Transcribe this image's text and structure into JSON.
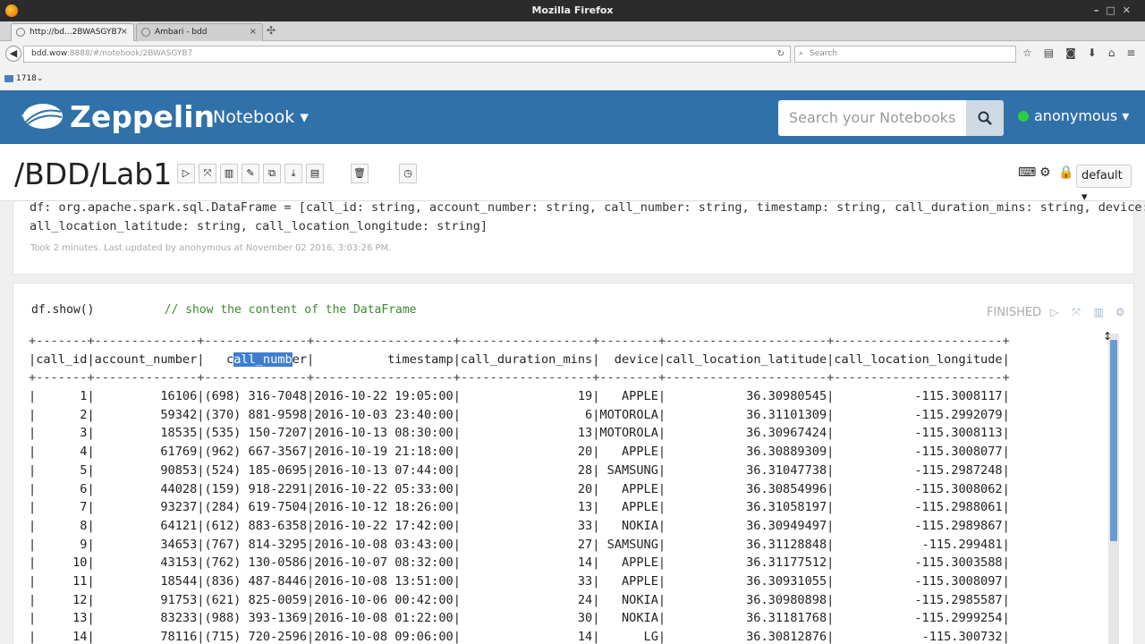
{
  "window": {
    "title": "Mozilla Firefox"
  },
  "tabs": [
    {
      "label": "http://bd...2BWASGYB7",
      "active": true
    },
    {
      "label": "Ambari - bdd",
      "active": false
    }
  ],
  "nav": {
    "url_host": "bdd.wow",
    "url_rest": ":8888/#/notebook/2BWASGYB7",
    "search_placeholder": "Search"
  },
  "bookmarks": {
    "item": "1718"
  },
  "zeppelin": {
    "brand": "Zeppelin",
    "notebook_menu": "Notebook ▾",
    "search_placeholder": "Search your Notebooks",
    "user": "anonymous ▾"
  },
  "notebook": {
    "title": "/BDD/Lab1",
    "interpreter": "default ▾"
  },
  "para1": {
    "output_lines": [
      "df: org.apache.spark.sql.DataFrame = [call_id: string, account_number: string, call_number: string, timestamp: string, call_duration_mins: string, device: string, c",
      "all_location_latitude: string, call_location_longitude: string]"
    ],
    "meta": "Took 2 minutes. Last updated by anonymous at November 02 2016, 3:03:26 PM."
  },
  "para2": {
    "code": "df.show()",
    "comment": "// show the content of the DataFrame",
    "status": "FINISHED",
    "border": "+-------+--------------+--------------+-------------------+------------------+--------+----------------------+-----------------------+",
    "header_cells": [
      "call_id",
      "account_number",
      "call_number",
      "timestamp",
      "call_duration_mins",
      "device",
      "call_location_latitude",
      "call_location_longitude"
    ],
    "rows": [
      [
        "1",
        "16106",
        "(698) 316-7048",
        "2016-10-22 19:05:00",
        "19",
        "APPLE",
        "36.30980545",
        "-115.3008117"
      ],
      [
        "2",
        "59342",
        "(370) 881-9598",
        "2016-10-03 23:40:00",
        "6",
        "MOTOROLA",
        "36.31101309",
        "-115.2992079"
      ],
      [
        "3",
        "18535",
        "(535) 150-7207",
        "2016-10-13 08:30:00",
        "13",
        "MOTOROLA",
        "36.30967424",
        "-115.3008113"
      ],
      [
        "4",
        "61769",
        "(962) 667-3567",
        "2016-10-19 21:18:00",
        "20",
        "APPLE",
        "36.30889309",
        "-115.3008077"
      ],
      [
        "5",
        "90853",
        "(524) 185-0695",
        "2016-10-13 07:44:00",
        "28",
        "SAMSUNG",
        "36.31047738",
        "-115.2987248"
      ],
      [
        "6",
        "44028",
        "(159) 918-2291",
        "2016-10-22 05:33:00",
        "20",
        "APPLE",
        "36.30854996",
        "-115.3008062"
      ],
      [
        "7",
        "93237",
        "(284) 619-7504",
        "2016-10-12 18:26:00",
        "13",
        "APPLE",
        "36.31058197",
        "-115.2988061"
      ],
      [
        "8",
        "64121",
        "(612) 883-6358",
        "2016-10-22 17:42:00",
        "33",
        "NOKIA",
        "36.30949497",
        "-115.2989867"
      ],
      [
        "9",
        "34653",
        "(767) 814-3295",
        "2016-10-08 03:43:00",
        "27",
        "SAMSUNG",
        "36.31128848",
        "-115.299481"
      ],
      [
        "10",
        "43153",
        "(762) 130-0586",
        "2016-10-07 08:32:00",
        "14",
        "APPLE",
        "36.31177512",
        "-115.3003588"
      ],
      [
        "11",
        "18544",
        "(836) 487-8446",
        "2016-10-08 13:51:00",
        "33",
        "APPLE",
        "36.30931055",
        "-115.3008097"
      ],
      [
        "12",
        "91753",
        "(621) 825-0059",
        "2016-10-06 00:42:00",
        "24",
        "NOKIA",
        "36.30980898",
        "-115.2985587"
      ],
      [
        "13",
        "83233",
        "(988) 393-1369",
        "2016-10-08 01:22:00",
        "30",
        "NOKIA",
        "36.31181768",
        "-115.2999254"
      ],
      [
        "14",
        "78116",
        "(715) 720-2596",
        "2016-10-08 09:06:00",
        "14",
        "LG",
        "36.30812876",
        "-115.300732"
      ]
    ]
  }
}
